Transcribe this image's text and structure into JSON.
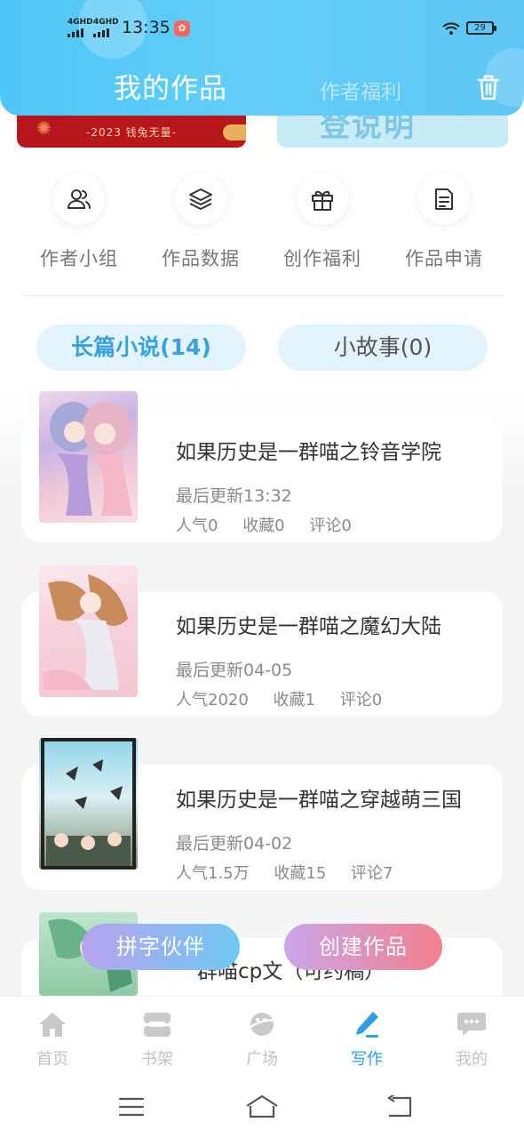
{
  "status_bar": {
    "signal1": "4GHD",
    "signal2": "4GHD",
    "time": "13:35",
    "battery": "29"
  },
  "header": {
    "tab_active": "我的作品",
    "tab_inactive": "作者福利",
    "trash_icon": "trash-icon"
  },
  "banners": {
    "left_text": "-2023 钱兔无量-",
    "right_text": "登说明"
  },
  "quick_actions": [
    {
      "label": "作者小组",
      "icon": "group-icon"
    },
    {
      "label": "作品数据",
      "icon": "layers-icon"
    },
    {
      "label": "创作福利",
      "icon": "gift-icon"
    },
    {
      "label": "作品申请",
      "icon": "document-icon"
    }
  ],
  "work_tabs": {
    "long": "长篇小说(14)",
    "short": "小故事(0)"
  },
  "works": [
    {
      "title": "如果历史是一群喵之铃音学院",
      "updated": "最后更新13:32",
      "popularity": "人气0",
      "favorites": "收藏0",
      "comments": "评论0"
    },
    {
      "title": "如果历史是一群喵之魔幻大陆",
      "updated": "最后更新04-05",
      "popularity": "人气2020",
      "favorites": "收藏1",
      "comments": "评论0"
    },
    {
      "title": "如果历史是一群喵之穿越萌三国",
      "updated": "最后更新04-02",
      "popularity": "人气1.5万",
      "favorites": "收藏15",
      "comments": "评论7"
    },
    {
      "title": "群喵cp文（可约稿）"
    }
  ],
  "fab": {
    "partner": "拼字伙伴",
    "create": "创建作品"
  },
  "bottom_nav": [
    {
      "label": "首页",
      "icon": "home-icon"
    },
    {
      "label": "书架",
      "icon": "bookshelf-icon"
    },
    {
      "label": "广场",
      "icon": "planet-icon"
    },
    {
      "label": "写作",
      "icon": "pen-icon",
      "active": true
    },
    {
      "label": "我的",
      "icon": "chat-bubble-icon"
    }
  ],
  "colors": {
    "header": "#4fc8f7",
    "accent": "#36a3e0",
    "active_nav": "#2f9ce6",
    "create_gradient_end": "#f47f8b"
  }
}
